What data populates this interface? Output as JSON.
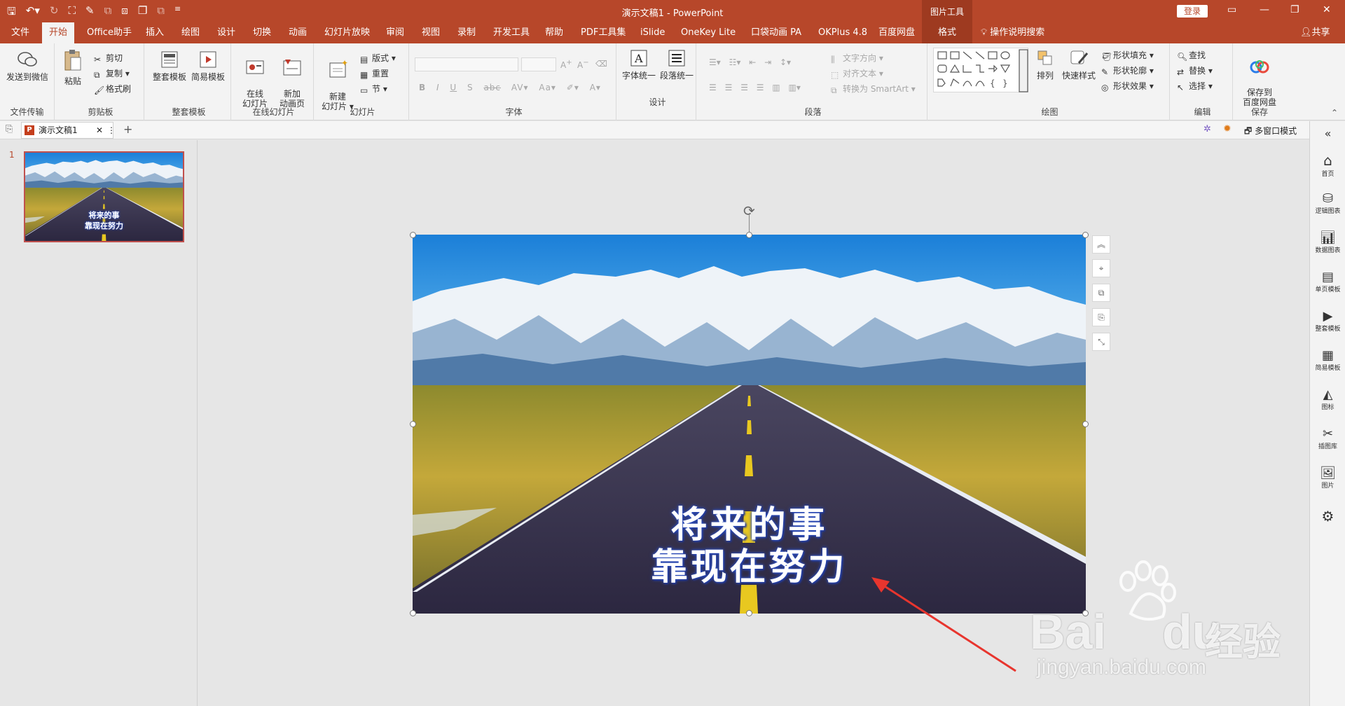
{
  "titlebar": {
    "doc_title": "演示文稿1  -  PowerPoint",
    "context_tab": "图片工具",
    "login": "登录"
  },
  "tabs": [
    "文件",
    "开始",
    "Office助手",
    "插入",
    "绘图",
    "设计",
    "切换",
    "动画",
    "幻灯片放映",
    "审阅",
    "视图",
    "录制",
    "开发工具",
    "帮助",
    "PDF工具集",
    "iSlide",
    "OneKey Lite",
    "口袋动画 PA",
    "OKPlus 4.8",
    "百度网盘",
    "格式"
  ],
  "tell_me": "操作说明搜索",
  "share": "共享",
  "ribbon": {
    "g_transfer": {
      "label": "文件传输",
      "send_wechat": "发送到微信"
    },
    "g_clipboard": {
      "label": "剪贴板",
      "paste": "粘贴",
      "cut": "剪切",
      "copy": "复制",
      "format_painter": "格式刷"
    },
    "g_template": {
      "label": "整套模板",
      "full_template": "整套模板",
      "simple_template": "简易模板"
    },
    "g_online": {
      "label": "在线幻灯片",
      "online_slide": "在线\n幻灯片",
      "new_anim": "新加\n动画页"
    },
    "g_slides": {
      "label": "幻灯片",
      "new_slide": "新建\n幻灯片",
      "layout": "版式",
      "reset": "重置",
      "section": "节"
    },
    "g_font": {
      "label": "字体"
    },
    "g_design": {
      "label": "设计",
      "font_unify": "字体统一",
      "para_unify": "段落统一"
    },
    "g_paragraph": {
      "label": "段落",
      "text_dir": "文字方向",
      "align_text": "对齐文本",
      "smartart": "转换为 SmartArt"
    },
    "g_drawing": {
      "label": "绘图",
      "arrange": "排列",
      "quick_style": "快速样式",
      "fill": "形状填充",
      "outline": "形状轮廓",
      "effect": "形状效果"
    },
    "g_edit": {
      "label": "编辑",
      "find": "查找",
      "replace": "替换",
      "select": "选择"
    },
    "g_save": {
      "label": "保存",
      "save_baidu": "保存到\n百度网盘"
    }
  },
  "docbar": {
    "doc_tab": "演示文稿1",
    "multi_window": "多窗口模式"
  },
  "thumbnail": {
    "number": "1",
    "line1": "将来的事",
    "line2": "靠现在努力"
  },
  "slide": {
    "line1": "将来的事",
    "line2": "靠现在努力"
  },
  "rightpane": [
    "首页",
    "逻辑图表",
    "数据图表",
    "单页模板",
    "整套模板",
    "简易模板",
    "图标",
    "插图库",
    "图片"
  ],
  "watermark": {
    "brand": "Bai",
    "brand2": "du",
    "cn": "经验",
    "url": "jingyan.baidu.com"
  },
  "colors": {
    "accent": "#b7472a",
    "arrow": "#e8352e"
  }
}
